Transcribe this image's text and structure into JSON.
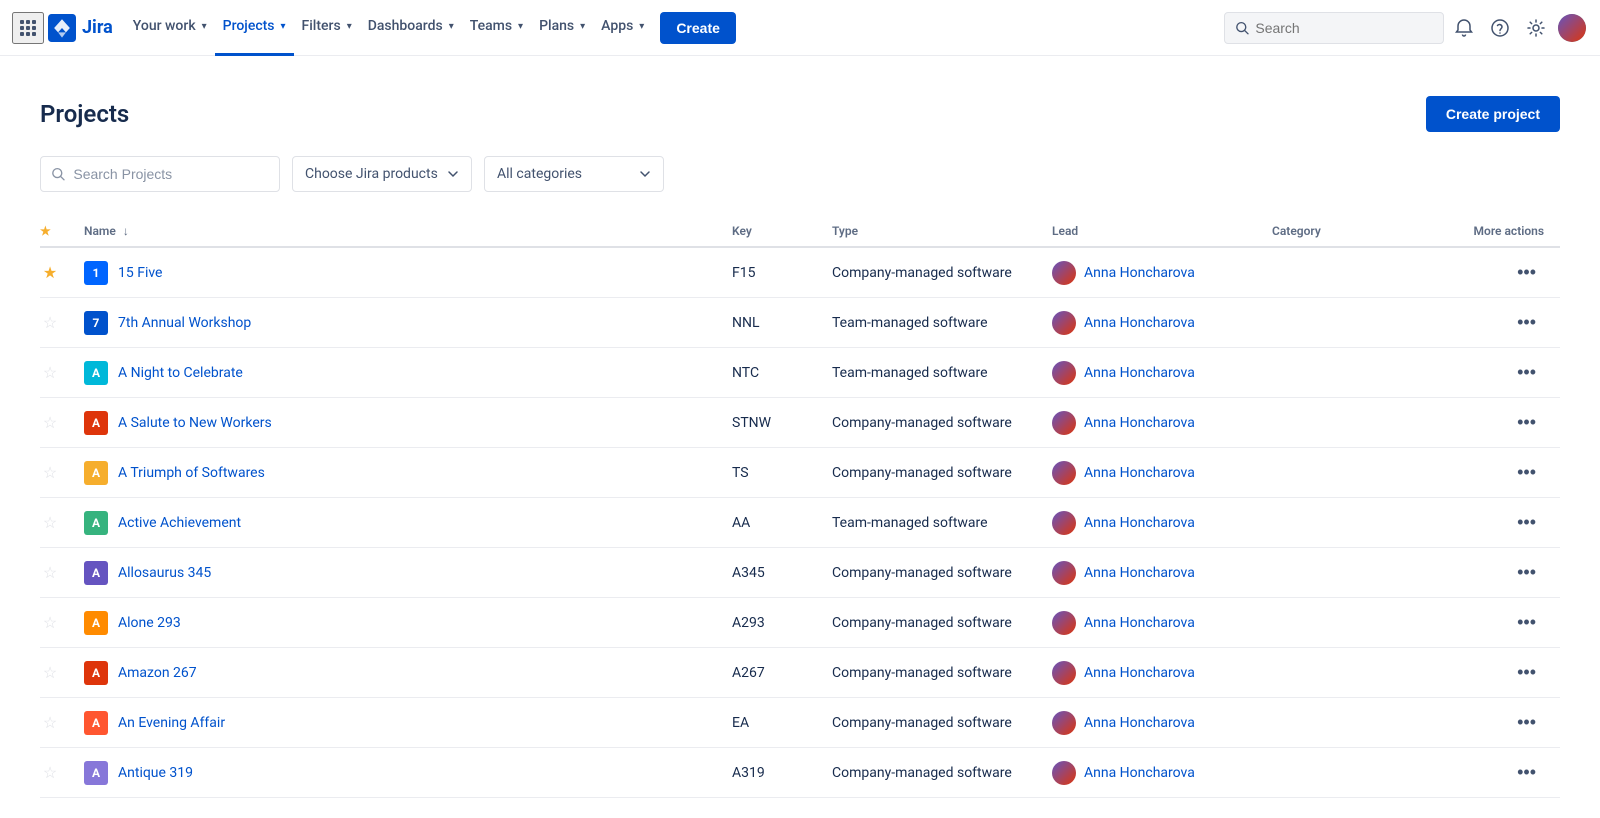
{
  "nav": {
    "logo_text": "Jira",
    "items": [
      {
        "label": "Your work",
        "id": "your-work",
        "has_dropdown": true,
        "active": false
      },
      {
        "label": "Projects",
        "id": "projects",
        "has_dropdown": true,
        "active": true
      },
      {
        "label": "Filters",
        "id": "filters",
        "has_dropdown": true,
        "active": false
      },
      {
        "label": "Dashboards",
        "id": "dashboards",
        "has_dropdown": true,
        "active": false
      },
      {
        "label": "Teams",
        "id": "teams",
        "has_dropdown": true,
        "active": false
      },
      {
        "label": "Plans",
        "id": "plans",
        "has_dropdown": true,
        "active": false
      },
      {
        "label": "Apps",
        "id": "apps",
        "has_dropdown": true,
        "active": false
      }
    ],
    "create_label": "Create",
    "search_placeholder": "Search"
  },
  "page": {
    "title": "Projects",
    "create_project_label": "Create project",
    "search_placeholder": "Search Projects",
    "jira_products_placeholder": "Choose Jira products",
    "categories_placeholder": "All categories"
  },
  "table": {
    "columns": {
      "name": "Name",
      "key": "Key",
      "type": "Type",
      "lead": "Lead",
      "category": "Category",
      "more_actions": "More actions"
    },
    "rows": [
      {
        "id": 1,
        "starred": true,
        "name": "15 Five",
        "icon_bg": "#0065ff",
        "icon_emoji": "🔵",
        "icon_color": "#0065ff",
        "key": "F15",
        "type": "Company-managed software",
        "lead": "Anna Honcharova"
      },
      {
        "id": 2,
        "starred": false,
        "name": "7th Annual Workshop",
        "icon_bg": "#0065ff",
        "icon_color": "#0065ff",
        "key": "NNL",
        "type": "Team-managed software",
        "lead": "Anna Honcharova"
      },
      {
        "id": 3,
        "starred": false,
        "name": "A Night to Celebrate",
        "icon_bg": "#00b8d9",
        "icon_color": "#00b8d9",
        "key": "NTC",
        "type": "Team-managed software",
        "lead": "Anna Honcharova"
      },
      {
        "id": 4,
        "starred": false,
        "name": "A Salute to New Workers",
        "icon_bg": "#de350b",
        "icon_color": "#de350b",
        "key": "STNW",
        "type": "Company-managed software",
        "lead": "Anna Honcharova"
      },
      {
        "id": 5,
        "starred": false,
        "name": "A Triumph of Softwares",
        "icon_bg": "#f6ae2d",
        "icon_color": "#f6ae2d",
        "key": "TS",
        "type": "Company-managed software",
        "lead": "Anna Honcharova"
      },
      {
        "id": 6,
        "starred": false,
        "name": "Active Achievement",
        "icon_bg": "#36b37e",
        "icon_color": "#36b37e",
        "key": "AA",
        "type": "Team-managed software",
        "lead": "Anna Honcharova"
      },
      {
        "id": 7,
        "starred": false,
        "name": "Allosaurus 345",
        "icon_bg": "#6554c0",
        "icon_color": "#6554c0",
        "key": "A345",
        "type": "Company-managed software",
        "lead": "Anna Honcharova"
      },
      {
        "id": 8,
        "starred": false,
        "name": "Alone 293",
        "icon_bg": "#f6ae2d",
        "icon_color": "#f6ae2d",
        "key": "A293",
        "type": "Company-managed software",
        "lead": "Anna Honcharova"
      },
      {
        "id": 9,
        "starred": false,
        "name": "Amazon 267",
        "icon_bg": "#de350b",
        "icon_color": "#de350b",
        "key": "A267",
        "type": "Company-managed software",
        "lead": "Anna Honcharova"
      },
      {
        "id": 10,
        "starred": false,
        "name": "An Evening Affair",
        "icon_bg": "#ff5630",
        "icon_color": "#ff5630",
        "key": "EA",
        "type": "Company-managed software",
        "lead": "Anna Honcharova"
      },
      {
        "id": 11,
        "starred": false,
        "name": "Antique 319",
        "icon_bg": "#8777d9",
        "icon_color": "#8777d9",
        "key": "A319",
        "type": "Company-managed software",
        "lead": "Anna Honcharova"
      }
    ]
  }
}
